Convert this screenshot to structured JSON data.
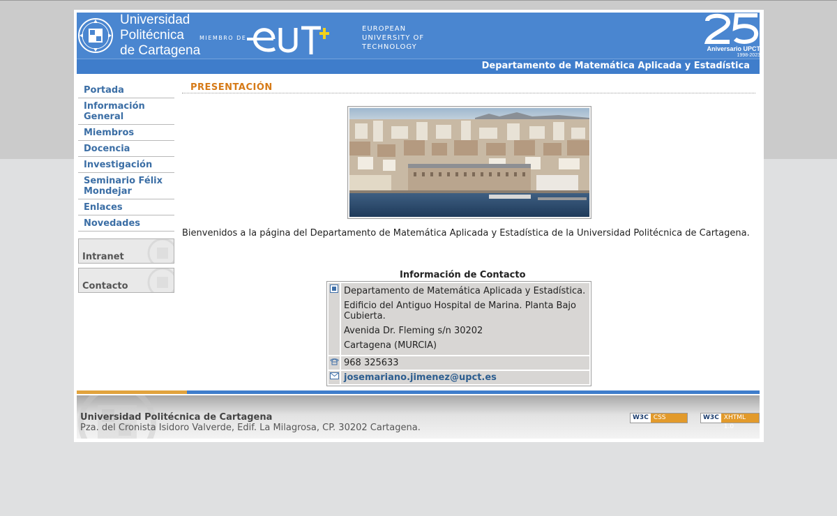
{
  "header": {
    "university_lines": [
      "Universidad",
      "Politécnica",
      "de Cartagena"
    ],
    "miembro_de": "MIEMBRO DE",
    "eut_lines": [
      "EUROPEAN",
      "UNIVERSITY OF",
      "TECHNOLOGY"
    ],
    "aniversario": "Aniversario UPCT",
    "aniversario_years": "1998-2023",
    "department": "Departamento de Matemática Aplicada y Estadística"
  },
  "sidebar": {
    "items": [
      {
        "label": "Portada"
      },
      {
        "label": "Información General"
      },
      {
        "label": "Miembros"
      },
      {
        "label": "Docencia"
      },
      {
        "label": "Investigación"
      },
      {
        "label": "Seminario Félix Mondejar"
      },
      {
        "label": "Enlaces"
      },
      {
        "label": "Novedades"
      }
    ],
    "buttons": [
      {
        "label": "Intranet"
      },
      {
        "label": "Contacto"
      }
    ]
  },
  "main": {
    "section_title": "PRESENTACIÓN",
    "welcome": "Bienvenidos a la página del Departamento de Matemática Aplicada y Estadística de la Universidad Politécnica de Cartagena.",
    "contact_title": "Información de Contacto",
    "contact": {
      "address_lines": [
        "Departamento de Matemática Aplicada y Estadística.",
        "Edificio del Antiguo Hospital de Marina. Planta Bajo Cubierta.",
        "Avenida Dr. Fleming s/n 30202",
        "Cartagena (MURCIA)"
      ],
      "phone": "968 325633",
      "email": "josemariano.jimenez@upct.es"
    }
  },
  "footer": {
    "name": "Universidad Politécnica de Cartagena",
    "address": "Pza. del Cronista Isidoro Valverde, Edif. La Milagrosa, CP. 30202 Cartagena.",
    "badges": [
      {
        "w3c": "W3C",
        "label": "CSS"
      },
      {
        "w3c": "W3C",
        "label": "XHTML 1.0"
      }
    ]
  },
  "colors": {
    "header_blue": "#4a86d0",
    "nav_link": "#3b6ea5",
    "section_title": "#d67a17",
    "eut_plus": "#f2d21b"
  },
  "icons": {
    "address": "building-icon",
    "phone": "phone-icon",
    "email": "envelope-icon"
  }
}
